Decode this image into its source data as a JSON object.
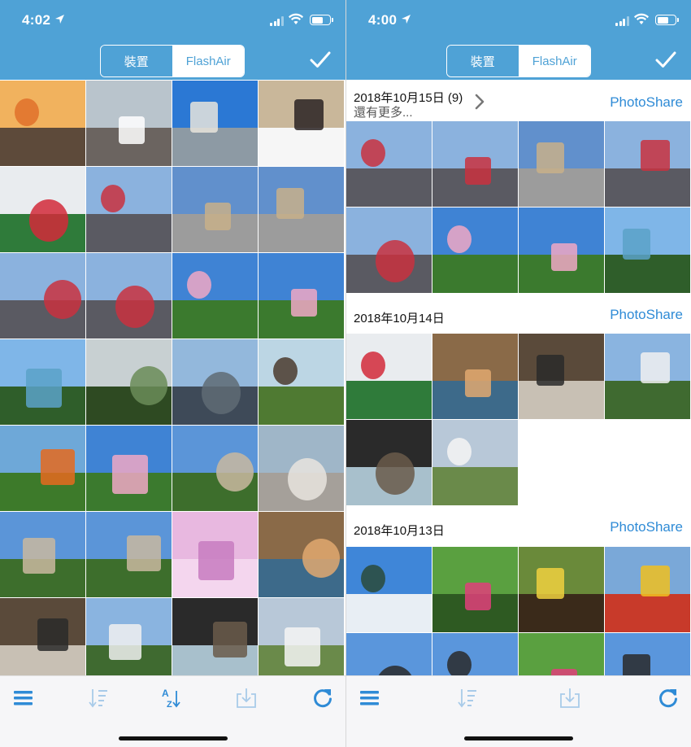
{
  "left_screen": {
    "status": {
      "time": "4:02"
    },
    "segments": [
      "裝置",
      "FlashAir"
    ],
    "selected_segment": "FlashAir"
  },
  "right_screen": {
    "status": {
      "time": "4:00"
    },
    "segments": [
      "裝置",
      "FlashAir"
    ],
    "selected_segment": "FlashAir",
    "sections": [
      {
        "title": "2018年10月15日 (9)",
        "subtitle": "還有更多...",
        "action": "PhotoShare"
      },
      {
        "title": "2018年10月14日",
        "subtitle": "",
        "action": "PhotoShare"
      },
      {
        "title": "2018年10月13日",
        "subtitle": "",
        "action": "PhotoShare"
      }
    ]
  },
  "colors": {
    "header_bg": "#4fa2d6",
    "accent": "#2f8bd6",
    "toolbar_bg": "#f6f6f8",
    "toolbar_icon": "#2f8bd6",
    "toolbar_icon_disabled": "#a8cbe9"
  },
  "icons": {
    "check": "checkmark-icon",
    "menu": "menu-icon",
    "sort": "sort-icon",
    "sort_alpha": "sort-alphabetical-icon",
    "download": "download-icon",
    "refresh": "refresh-icon",
    "chevron": "chevron-right-icon"
  }
}
